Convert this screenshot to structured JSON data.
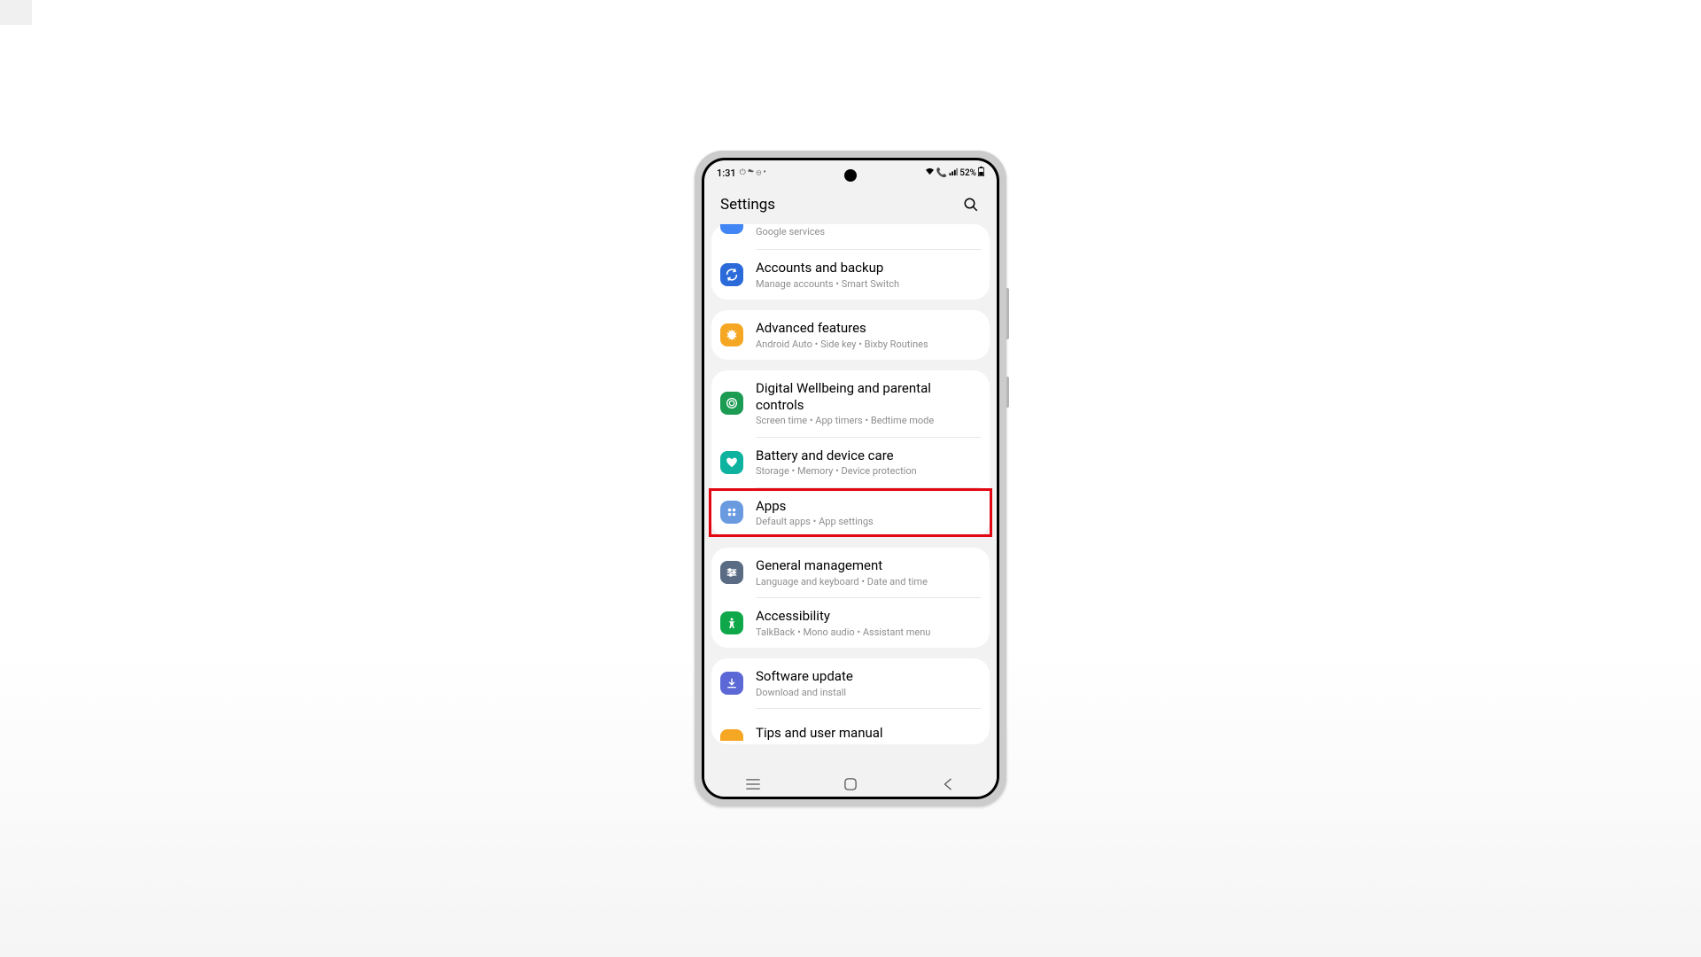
{
  "status": {
    "time": "1:31",
    "indicators": "⏻ ☁ ⊖ •",
    "battery": "52%"
  },
  "header": {
    "title": "Settings"
  },
  "groups": [
    {
      "items": [
        {
          "id": "google-services",
          "partial": "top",
          "subtitle": "Google services"
        },
        {
          "id": "accounts-backup",
          "title": "Accounts and backup",
          "subtitle": "Manage accounts  •  Smart Switch",
          "icon_bg": "bg-blue",
          "icon_name": "refresh-icon"
        }
      ]
    },
    {
      "items": [
        {
          "id": "advanced-features",
          "title": "Advanced features",
          "subtitle": "Android Auto  •  Side key  •  Bixby Routines",
          "icon_bg": "bg-orange",
          "icon_name": "gear-icon"
        }
      ]
    },
    {
      "items": [
        {
          "id": "digital-wellbeing",
          "title": "Digital Wellbeing and parental controls",
          "subtitle": "Screen time  •  App timers  •  Bedtime mode",
          "icon_bg": "bg-green",
          "icon_name": "target-icon"
        },
        {
          "id": "battery-device",
          "title": "Battery and device care",
          "subtitle": "Storage  •  Memory  •  Device protection",
          "icon_bg": "bg-teal",
          "icon_name": "heart-icon"
        },
        {
          "id": "apps",
          "title": "Apps",
          "subtitle": "Default apps  •  App settings",
          "icon_bg": "bg-lightblue",
          "icon_name": "grid-icon",
          "highlighted": true
        }
      ]
    },
    {
      "items": [
        {
          "id": "general-mgmt",
          "title": "General management",
          "subtitle": "Language and keyboard  •  Date and time",
          "icon_bg": "bg-darkblue",
          "icon_name": "sliders-icon"
        },
        {
          "id": "accessibility",
          "title": "Accessibility",
          "subtitle": "TalkBack  •  Mono audio  •  Assistant menu",
          "icon_bg": "bg-lime",
          "icon_name": "person-icon"
        }
      ]
    },
    {
      "items": [
        {
          "id": "software-update",
          "title": "Software update",
          "subtitle": "Download and install",
          "icon_bg": "bg-purple",
          "icon_name": "download-icon"
        },
        {
          "id": "tips-manual",
          "partial": "bottom",
          "title": "Tips and user manual"
        }
      ]
    }
  ]
}
